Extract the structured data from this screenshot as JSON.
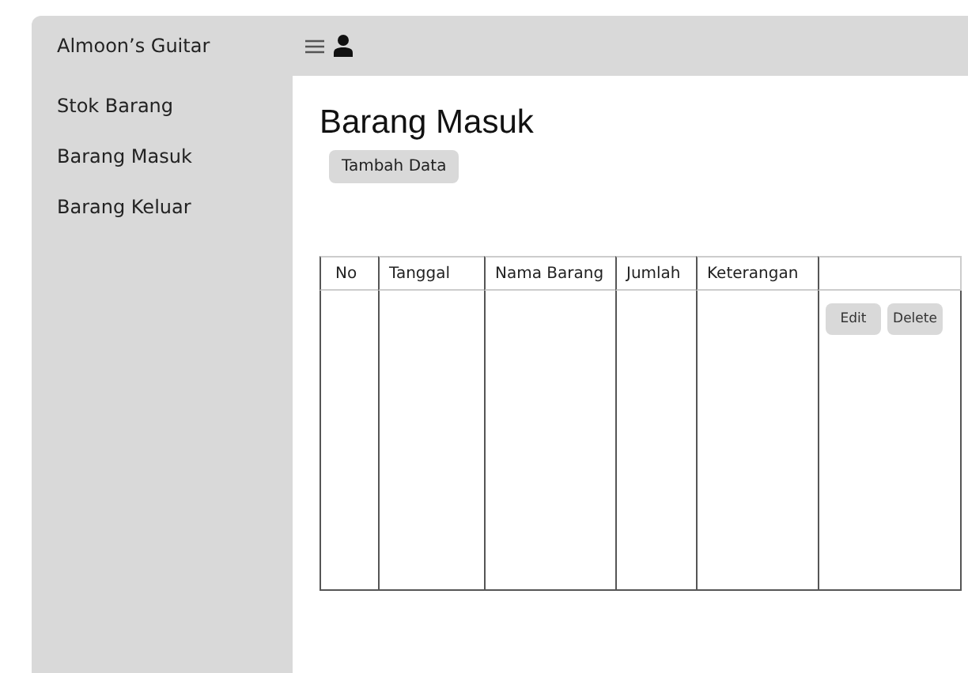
{
  "app_bar": {
    "brand": "Almoon’s Guitar"
  },
  "sidebar": {
    "items": [
      {
        "label": "Stok Barang"
      },
      {
        "label": "Barang Masuk"
      },
      {
        "label": "Barang Keluar"
      }
    ]
  },
  "page": {
    "title": "Barang Masuk",
    "add_button": "Tambah Data"
  },
  "table": {
    "columns": [
      "No",
      "Tanggal",
      "Nama Barang",
      "Jumlah",
      "Keterangan"
    ],
    "row_actions": [
      "Edit",
      "Delete"
    ]
  }
}
